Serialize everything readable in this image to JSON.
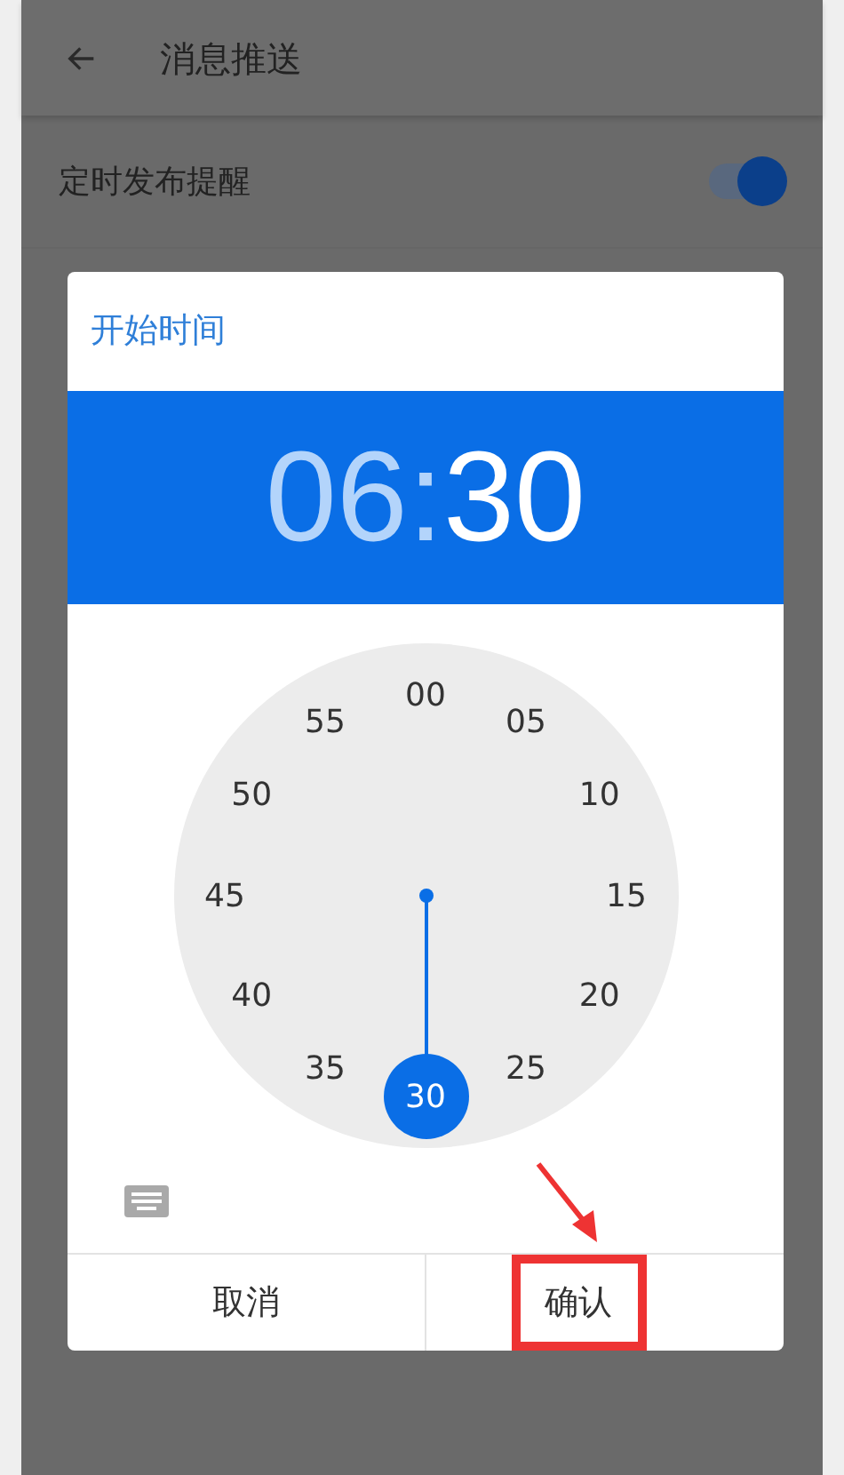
{
  "header": {
    "title": "消息推送"
  },
  "settings": [
    {
      "label": "定时发布提醒",
      "on": true
    }
  ],
  "dialog": {
    "title": "开始时间",
    "hours": {
      "text": "06",
      "selected": false
    },
    "separator": ":",
    "minutes": {
      "text": "30",
      "selected": true
    },
    "clock": [
      {
        "label": "00",
        "selected": false
      },
      {
        "label": "05",
        "selected": false
      },
      {
        "label": "10",
        "selected": false
      },
      {
        "label": "15",
        "selected": false
      },
      {
        "label": "20",
        "selected": false
      },
      {
        "label": "25",
        "selected": false
      },
      {
        "label": "30",
        "selected": true
      },
      {
        "label": "35",
        "selected": false
      },
      {
        "label": "40",
        "selected": false
      },
      {
        "label": "45",
        "selected": false
      },
      {
        "label": "50",
        "selected": false
      },
      {
        "label": "55",
        "selected": false
      }
    ],
    "buttons": [
      {
        "label": "取消",
        "highlighted": false
      },
      {
        "label": "确认",
        "highlighted": true
      }
    ]
  }
}
